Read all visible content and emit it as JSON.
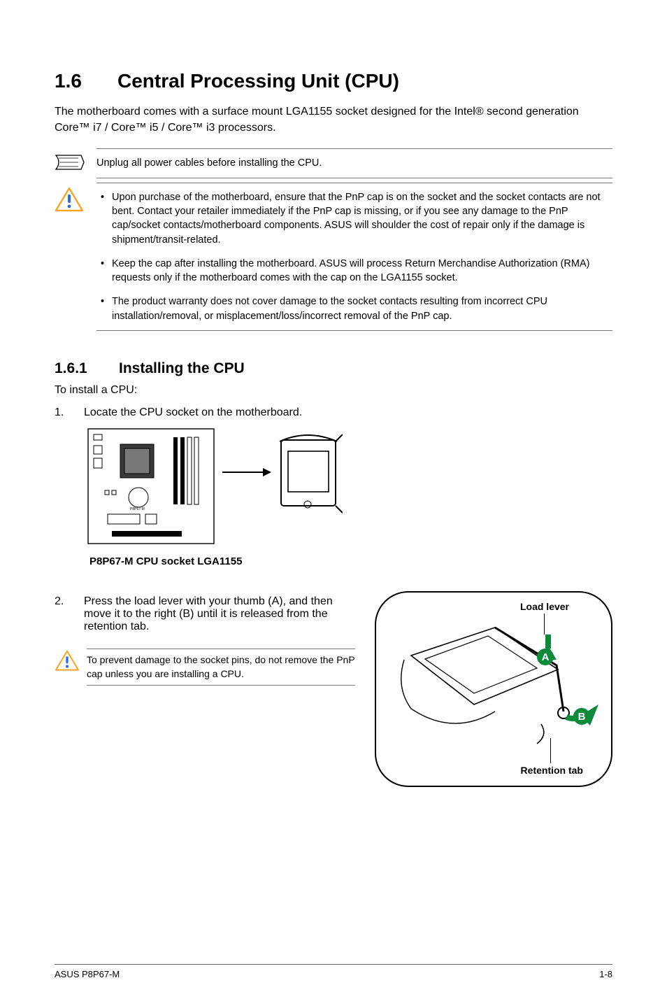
{
  "section": {
    "number": "1.6",
    "title": "Central Processing Unit (CPU)"
  },
  "intro": "The motherboard comes with a surface mount LGA1155 socket designed for the Intel® second generation Core™ i7 / Core™ i5 / Core™ i3 processors.",
  "note_single": "Unplug all power cables before installing the CPU.",
  "warnings": [
    "Upon purchase of the motherboard, ensure that the PnP cap is on the socket and the socket contacts are not bent. Contact your retailer immediately if the PnP cap is missing, or if you see any damage to the PnP cap/socket contacts/motherboard components. ASUS will shoulder the cost of repair only if the damage is shipment/transit-related.",
    "Keep the cap after installing the motherboard. ASUS will process Return Merchandise Authorization (RMA) requests only if the motherboard comes with the cap on the LGA1155 socket.",
    "The product warranty does not cover damage to the socket contacts resulting from incorrect CPU installation/removal, or misplacement/loss/incorrect removal of the PnP cap."
  ],
  "subsection": {
    "number": "1.6.1",
    "title": "Installing the CPU"
  },
  "sub_intro": "To install a CPU:",
  "steps": {
    "s1_num": "1.",
    "s1_text": "Locate the CPU socket on the motherboard.",
    "diagram_caption": "P8P67-M CPU socket LGA1155",
    "s2_num": "2.",
    "s2_text": "Press the load lever with your thumb (A), and then move it to the right (B) until it is released from the retention tab."
  },
  "inner_warning": "To prevent damage to the socket pins, do not remove the PnP cap unless you are installing a CPU.",
  "callout_labels": {
    "top": "Load lever",
    "bottom": "Retention tab",
    "badge_a": "A",
    "badge_b": "B"
  },
  "footer": {
    "left": "ASUS P8P67-M",
    "right": "1-8"
  }
}
